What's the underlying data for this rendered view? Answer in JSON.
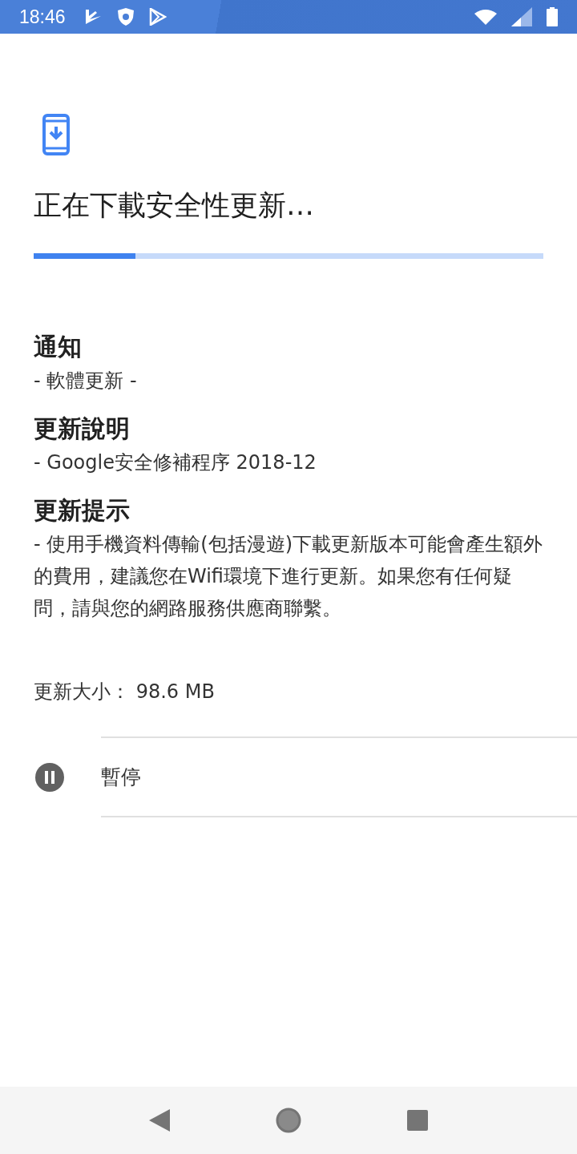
{
  "status_bar": {
    "time": "18:46"
  },
  "title": "正在下載安全性更新…",
  "progress": {
    "level": 0.2
  },
  "sections": [
    {
      "heading": "通知",
      "body": "- 軟體更新 -"
    },
    {
      "heading": "更新說明",
      "body": "- Google安全修補程序 2018-12"
    },
    {
      "heading": "更新提示",
      "body": "- 使用手機資料傳輸(包括漫遊)下載更新版本可能會產生額外的費用，建議您在Wifi環境下進行更新。如果您有任何疑問，請與您的網路服務供應商聯繫。"
    }
  ],
  "update_size": "更新大小： 98.6 MB",
  "actions": [
    {
      "kind": "pause",
      "label": "暫停"
    }
  ]
}
